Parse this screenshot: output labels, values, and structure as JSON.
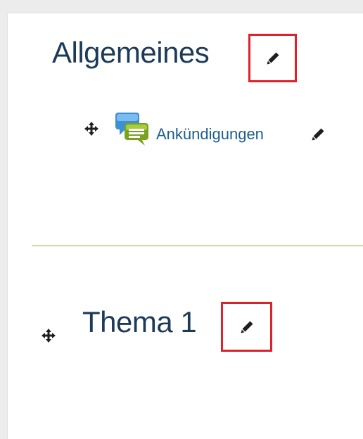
{
  "sections": [
    {
      "title": "Allgemeines",
      "edit_icon": "pencil-icon",
      "activities": [
        {
          "label": "Ankündigungen",
          "type_icon": "forum-icon",
          "move_icon": "move-icon",
          "edit_icon": "pencil-icon"
        }
      ]
    },
    {
      "title": "Thema 1",
      "move_icon": "move-icon",
      "edit_icon": "pencil-icon"
    }
  ],
  "colors": {
    "title": "#1d3b59",
    "link": "#1d5f8f",
    "highlight_box": "#e0202a",
    "divider": "#97b23a",
    "icon": "#1f1f1f"
  }
}
